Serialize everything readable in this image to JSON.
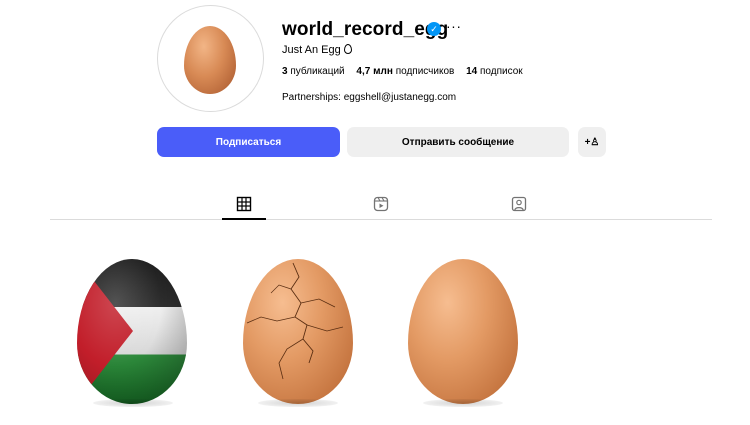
{
  "profile": {
    "username": "world_record_egg",
    "full_name": "Just An Egg",
    "stats": {
      "posts_count": "3",
      "posts_label": "публикаций",
      "followers_count": "4,7 млн",
      "followers_label": "подписчиков",
      "following_count": "14",
      "following_label": "подписок"
    },
    "partnerships": "Partnerships: eggshell@justanegg.com"
  },
  "actions": {
    "follow_label": "Подписаться",
    "message_label": "Отправить сообщение",
    "add_user_label": "+♙"
  },
  "tabs": [
    {
      "icon": "grid-icon",
      "active": true
    },
    {
      "icon": "reels-icon",
      "active": false
    },
    {
      "icon": "tagged-icon",
      "active": false
    }
  ],
  "posts": [
    {
      "icon": "egg-palestine-flag"
    },
    {
      "icon": "egg-cracked"
    },
    {
      "icon": "egg-plain"
    }
  ],
  "colors": {
    "follow_button": "#4a5df9",
    "secondary_button": "#efefef",
    "verified_badge": "#0095f6"
  }
}
